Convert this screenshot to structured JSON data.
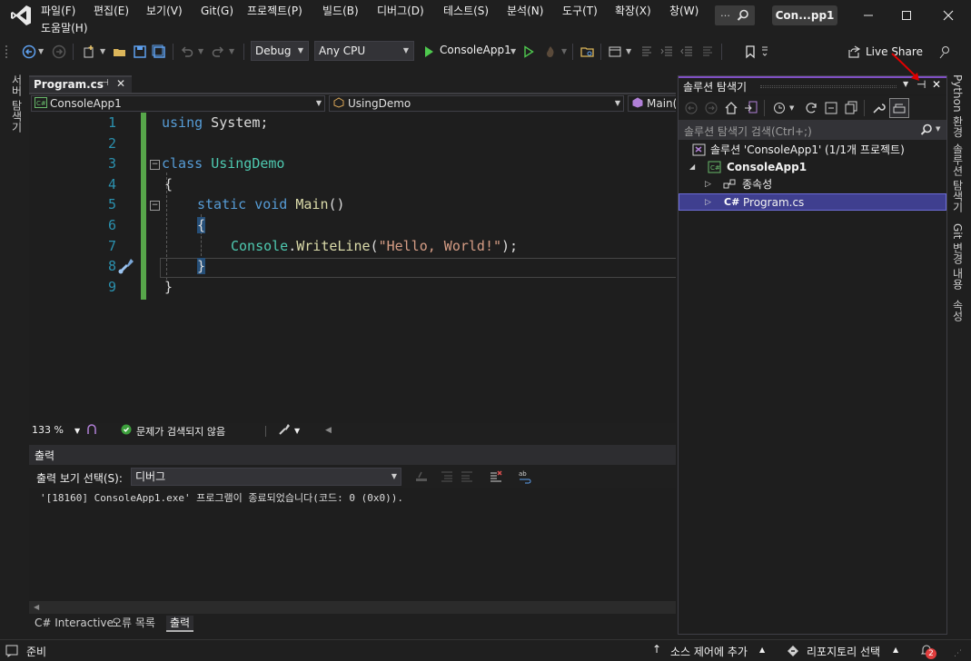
{
  "menu": {
    "items": [
      "파일(F)",
      "편집(E)",
      "보기(V)",
      "Git(G)",
      "프로젝트(P)",
      "빌드(B)",
      "디버그(D)",
      "테스트(S)",
      "분석(N)",
      "도구(T)",
      "확장(X)",
      "창(W)"
    ],
    "help": "도움말(H)",
    "search_dots": "…",
    "window_title": "Con...pp1"
  },
  "toolbar": {
    "configuration": "Debug",
    "platform": "Any CPU",
    "start_target": "ConsoleApp1",
    "live_share": "Live Share"
  },
  "left_strip": {
    "server_explorer": "서버 탐색기"
  },
  "editor": {
    "tab_name": "Program.cs",
    "nav_project": "ConsoleApp1",
    "nav_class": "UsingDemo",
    "nav_member": "Main(",
    "line_numbers": [
      "1",
      "2",
      "3",
      "4",
      "5",
      "6",
      "7",
      "8",
      "9"
    ],
    "code": {
      "l1_kw": "using",
      "l1_ns": " System;",
      "l3_kw": "class",
      "l3_name": "UsingDemo",
      "l4": "{",
      "l5_static": "static",
      "l5_void": "void",
      "l5_main": "Main",
      "l5_parens": "()",
      "l6": "{",
      "l7_console": "Console",
      "l7_dot": ".",
      "l7_method": "WriteLine",
      "l7_open": "(",
      "l7_str": "\"Hello, World!\"",
      "l7_close": ");",
      "l8": "}",
      "l9": "}"
    },
    "zoom": "133 %",
    "issues": "문제가 검색되지 않음"
  },
  "output": {
    "title": "출력",
    "source_label": "출력 보기 선택(S):",
    "source_value": "디버그",
    "text": "'[18160] ConsoleApp1.exe' 프로그램이 종료되었습니다(코드: 0 (0x0)).",
    "tabs": [
      "C# Interactive",
      "오류 목록",
      "출력"
    ]
  },
  "solution_explorer": {
    "title": "솔루션 탐색기",
    "search_placeholder": "솔루션 탐색기 검색(Ctrl+;)",
    "solution": "솔루션 'ConsoleApp1' (1/1개 프로젝트)",
    "project": "ConsoleApp1",
    "dependencies": "종속성",
    "file": "Program.cs",
    "project_icon_text": "C#",
    "file_icon_text": "C#"
  },
  "right_strip": [
    "Python 환경",
    "솔루션 탐색기",
    "Git 변경 내용",
    "속성"
  ],
  "statusbar": {
    "ready": "준비",
    "source_control": "소스 제어에 추가",
    "repository": "리포지토리 선택",
    "notifications": "2"
  },
  "colors": {
    "accent_purple": "#7f4fc4",
    "change_green": "#57a64a",
    "annotation_red": "#e00000"
  }
}
